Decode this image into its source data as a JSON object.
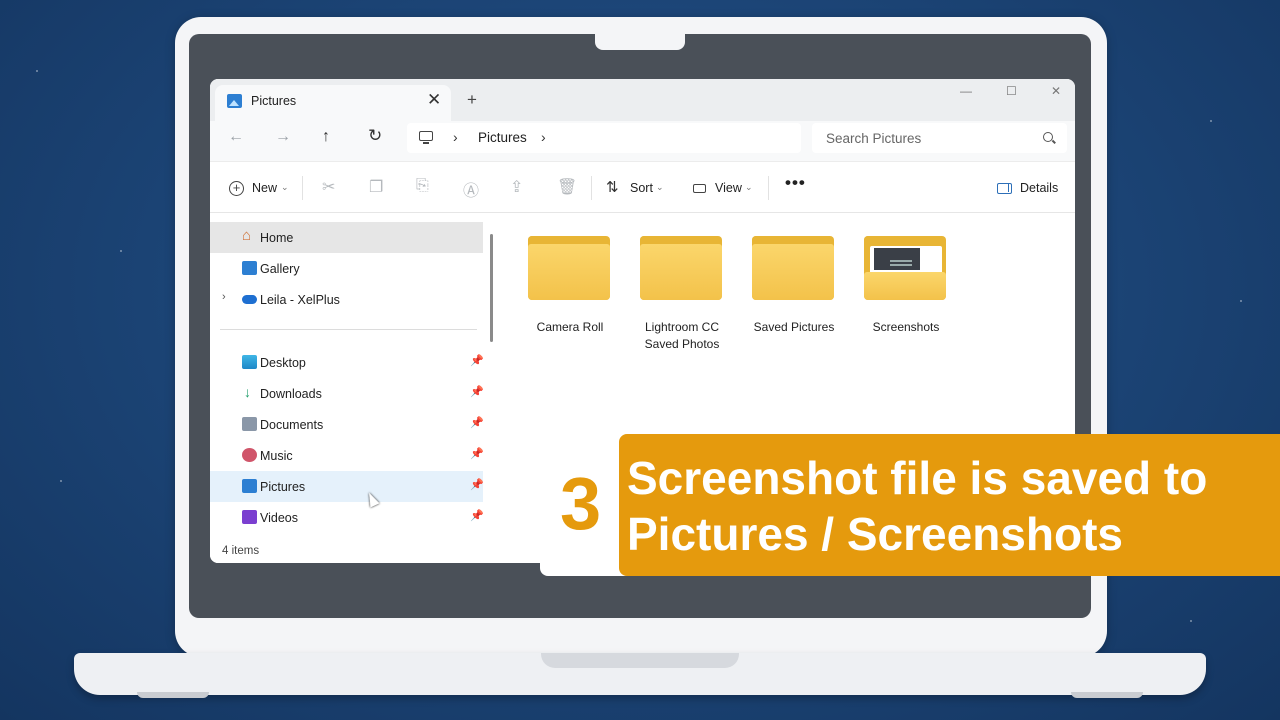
{
  "window": {
    "tab_title": "Pictures",
    "tab_close": "✕",
    "new_tab": "+",
    "controls": {
      "minimize": "—",
      "maximize": "☐",
      "close": "✕"
    }
  },
  "address_bar": {
    "back": "←",
    "forward": "→",
    "up": "↑",
    "refresh": "↻",
    "separator": "›",
    "breadcrumb": "Pictures",
    "search_placeholder": "Search Pictures"
  },
  "toolbar": {
    "new_label": "New",
    "sort_label": "Sort",
    "view_label": "View",
    "more": "•••",
    "details_label": "Details",
    "disabled_icons": [
      "cut-icon",
      "copy-icon",
      "paste-icon",
      "rename-icon",
      "share-icon",
      "delete-icon"
    ]
  },
  "sidebar": {
    "items": [
      {
        "label": "Home",
        "icon": "home-icon",
        "selected": true
      },
      {
        "label": "Gallery",
        "icon": "gallery-icon"
      },
      {
        "label": "Leila - XelPlus",
        "icon": "onedrive-icon",
        "expandable": true
      }
    ],
    "pinned": [
      {
        "label": "Desktop",
        "icon": "desktop-icon"
      },
      {
        "label": "Downloads",
        "icon": "downloads-icon"
      },
      {
        "label": "Documents",
        "icon": "documents-icon"
      },
      {
        "label": "Music",
        "icon": "music-icon"
      },
      {
        "label": "Pictures",
        "icon": "pictures-icon",
        "hover": true
      },
      {
        "label": "Videos",
        "icon": "videos-icon"
      }
    ],
    "pin_glyph": "📌"
  },
  "content": {
    "folders": [
      {
        "name": "Camera Roll"
      },
      {
        "name_line1": "Lightroom CC",
        "name_line2": "Saved Photos"
      },
      {
        "name": "Saved Pictures"
      },
      {
        "name": "Screenshots"
      }
    ]
  },
  "status": {
    "item_count": "4 items"
  },
  "banner": {
    "number": "3",
    "line1": "Screenshot file is saved to",
    "line2": "Pictures / Screenshots"
  },
  "colors": {
    "accent": "#e59a0d",
    "folder": "#f3c24a",
    "background": "#1b4374"
  }
}
